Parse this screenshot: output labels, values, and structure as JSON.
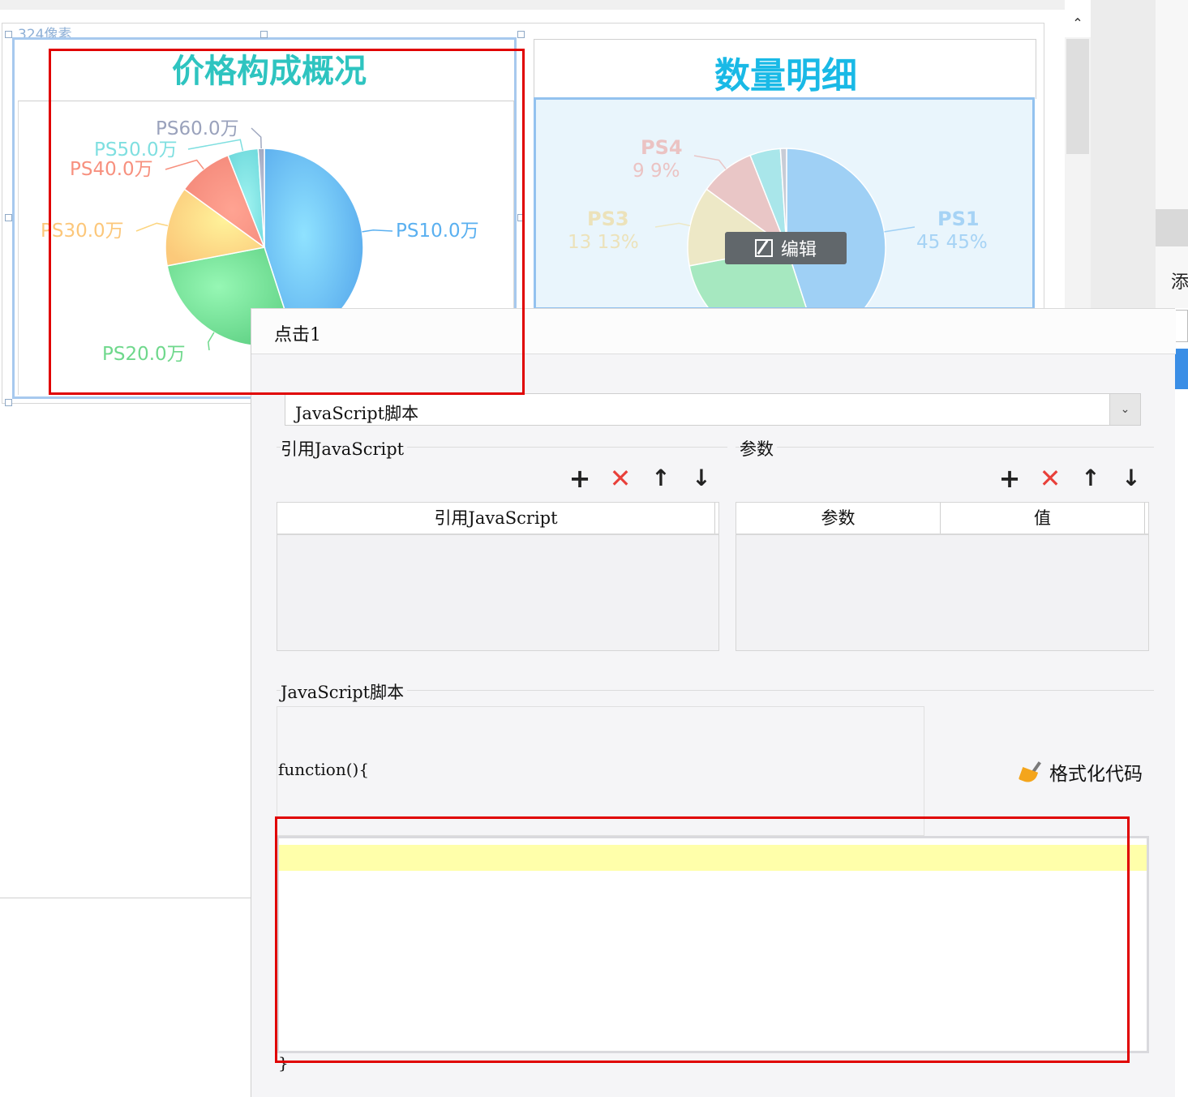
{
  "canvas": {
    "size_label": "324像素"
  },
  "widget1": {
    "title": "价格构成概况",
    "labels": [
      "PS10.0万",
      "PS20.0万",
      "PS30.0万",
      "PS40.0万",
      "PS50.0万",
      "PS60.0万"
    ]
  },
  "widget2": {
    "title": "数量明细",
    "labels": [
      {
        "name": "PS1",
        "value": "45  45%"
      },
      {
        "name": "PS3",
        "value": "13  13%"
      },
      {
        "name": "PS4",
        "value": "9  9%"
      }
    ],
    "edit_label": "编辑"
  },
  "chart_data": [
    {
      "type": "pie",
      "title": "价格构成概况",
      "categories": [
        "PS1",
        "PS2",
        "PS3",
        "PS4",
        "PS5",
        "PS6"
      ],
      "values": [
        45,
        27,
        13,
        9,
        5,
        1
      ],
      "labels": [
        "PS10.0万",
        "PS20.0万",
        "PS30.0万",
        "PS40.0万",
        "PS50.0万",
        "PS60.0万"
      ],
      "colors": [
        "#5ab0f0",
        "#6fd88c",
        "#fcd580",
        "#f7907e",
        "#7fdfe0",
        "#a0a8c0"
      ]
    },
    {
      "type": "pie",
      "title": "数量明细",
      "categories": [
        "PS1",
        "PS2",
        "PS3",
        "PS4",
        "PS5",
        "PS6"
      ],
      "values": [
        45,
        27,
        13,
        9,
        5,
        1
      ],
      "labels": [
        "PS1 45 45%",
        "",
        "PS3 13 13%",
        "PS4 9 9%",
        "",
        ""
      ],
      "colors": [
        "#9fd0f5",
        "#a6e8c0",
        "#ede8c6",
        "#e9c6c6",
        "#a9e6ea",
        "#c8ccd6"
      ]
    }
  ],
  "dialog": {
    "title": "点击1",
    "type_select": "JavaScript脚本",
    "ref_js": {
      "legend": "引用JavaScript",
      "column": "引用JavaScript"
    },
    "params": {
      "legend": "参数",
      "columns": [
        "参数",
        "值"
      ]
    },
    "toolbar_icons": [
      "plus-icon",
      "delete-icon",
      "arrow-up-icon",
      "arrow-down-icon"
    ],
    "script": {
      "legend": "JavaScript脚本",
      "code_start": "function(){",
      "code_end": "}",
      "format_label": "格式化代码"
    }
  },
  "colors": {
    "highlight": "#e00000",
    "accent_blue": "#3a8ee6",
    "editor_line": "#ffffaa"
  }
}
